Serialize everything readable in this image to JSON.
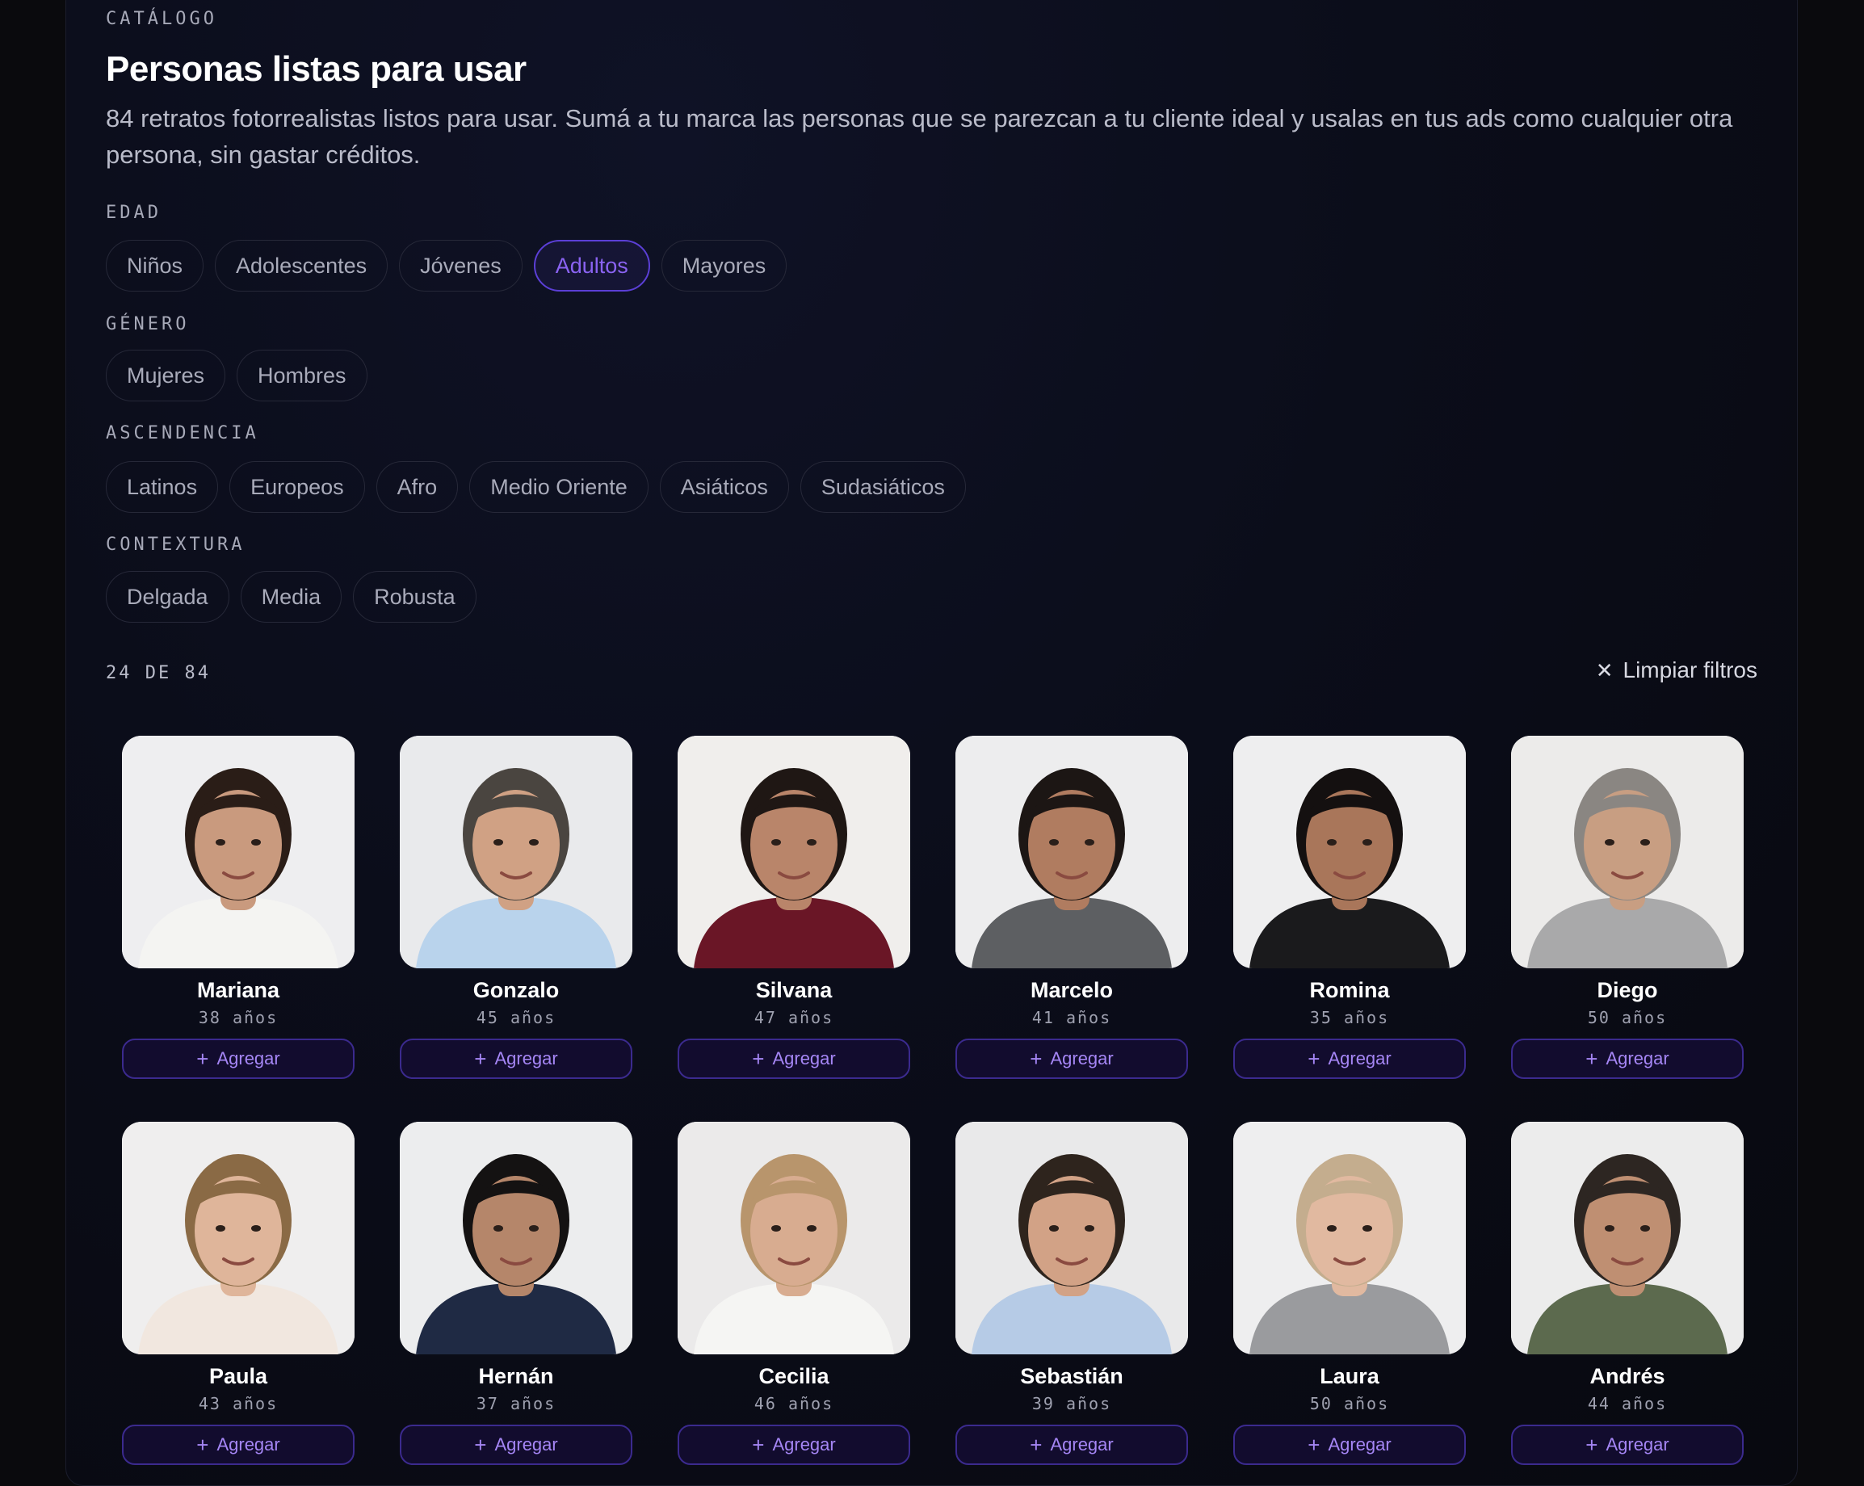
{
  "header": {
    "eyebrow": "CATÁLOGO",
    "title": "Personas listas para usar",
    "description": "84 retratos fotorrealistas listos para usar. Sumá a tu marca las personas que se parezcan a tu cliente ideal y usalas en tus ads como cualquier otra persona, sin gastar créditos."
  },
  "filters": [
    {
      "label": "EDAD",
      "chips": [
        {
          "label": "Niños",
          "active": false
        },
        {
          "label": "Adolescentes",
          "active": false
        },
        {
          "label": "Jóvenes",
          "active": false
        },
        {
          "label": "Adultos",
          "active": true
        },
        {
          "label": "Mayores",
          "active": false
        }
      ]
    },
    {
      "label": "GÉNERO",
      "chips": [
        {
          "label": "Mujeres",
          "active": false
        },
        {
          "label": "Hombres",
          "active": false
        }
      ]
    },
    {
      "label": "ASCENDENCIA",
      "chips": [
        {
          "label": "Latinos",
          "active": false
        },
        {
          "label": "Europeos",
          "active": false
        },
        {
          "label": "Afro",
          "active": false
        },
        {
          "label": "Medio Oriente",
          "active": false
        },
        {
          "label": "Asiáticos",
          "active": false
        },
        {
          "label": "Sudasiáticos",
          "active": false
        }
      ]
    },
    {
      "label": "CONTEXTURA",
      "chips": [
        {
          "label": "Delgada",
          "active": false
        },
        {
          "label": "Media",
          "active": false
        },
        {
          "label": "Robusta",
          "active": false
        }
      ]
    }
  ],
  "results": {
    "count": "24 DE 84",
    "clear_label": "Limpiar filtros",
    "clear_icon": "close-icon"
  },
  "add_label": "Agregar",
  "add_icon": "plus-icon",
  "personas": [
    {
      "name": "Mariana",
      "age": "38 años",
      "hair": "#2a1d17",
      "skin": "#c99a7e",
      "shirt": "#f4f4f2",
      "bg": "#eeeef0"
    },
    {
      "name": "Gonzalo",
      "age": "45 años",
      "hair": "#4a4540",
      "skin": "#d0a184",
      "shirt": "#b9d3ec",
      "bg": "#e9eaec"
    },
    {
      "name": "Silvana",
      "age": "47 años",
      "hair": "#1f1714",
      "skin": "#b9856a",
      "shirt": "#6a1626",
      "bg": "#f0eeec"
    },
    {
      "name": "Marcelo",
      "age": "41 años",
      "hair": "#1c1614",
      "skin": "#b07c60",
      "shirt": "#5d5f62",
      "bg": "#ededee"
    },
    {
      "name": "Romina",
      "age": "35 años",
      "hair": "#141010",
      "skin": "#a9765a",
      "shirt": "#1a1a1c",
      "bg": "#eeeeef"
    },
    {
      "name": "Diego",
      "age": "50 años",
      "hair": "#8a8682",
      "skin": "#c89e82",
      "shirt": "#a9a9aa",
      "bg": "#ecebea"
    },
    {
      "name": "Paula",
      "age": "43 años",
      "hair": "#8a6a45",
      "skin": "#dfb59a",
      "shirt": "#f1e7df",
      "bg": "#efeeee"
    },
    {
      "name": "Hernán",
      "age": "37 años",
      "hair": "#141212",
      "skin": "#b5866a",
      "shirt": "#1f2a44",
      "bg": "#ecedee"
    },
    {
      "name": "Cecilia",
      "age": "46 años",
      "hair": "#b8956c",
      "skin": "#d8ac90",
      "shirt": "#f5f5f3",
      "bg": "#ebeaea"
    },
    {
      "name": "Sebastián",
      "age": "39 años",
      "hair": "#2e241d",
      "skin": "#d2a286",
      "shirt": "#b6cbe6",
      "bg": "#e9e9ea"
    },
    {
      "name": "Laura",
      "age": "50 años",
      "hair": "#c4ad8e",
      "skin": "#e1b9a0",
      "shirt": "#9a9b9e",
      "bg": "#eeeeef"
    },
    {
      "name": "Andrés",
      "age": "44 años",
      "hair": "#2d2622",
      "skin": "#bf8f72",
      "shirt": "#5c6a4e",
      "bg": "#ececec"
    }
  ]
}
